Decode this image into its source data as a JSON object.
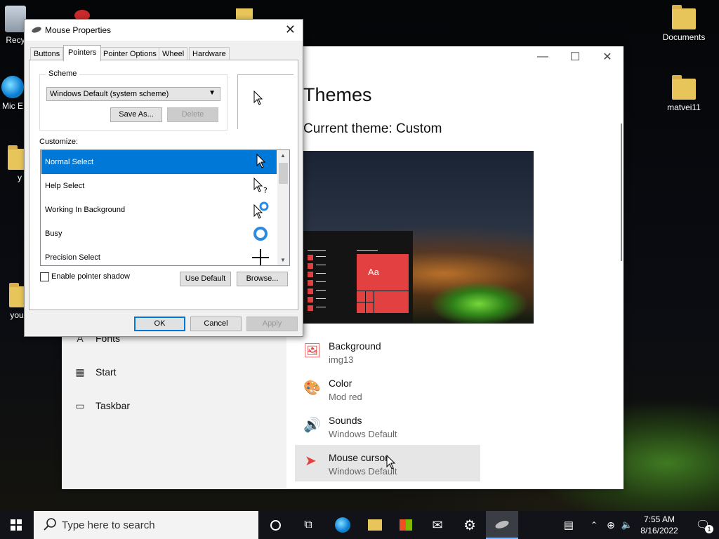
{
  "desktop": {
    "icons": [
      {
        "label": "Recy"
      },
      {
        "label": "Mic E"
      },
      {
        "label": "y"
      },
      {
        "label": "you w"
      },
      {
        "label": "Documents"
      },
      {
        "label": "matvei11"
      }
    ]
  },
  "settings": {
    "title": "Themes",
    "current_theme": "Current theme: Custom",
    "preview_tile_text": "Aa",
    "nav": [
      {
        "label": "Fonts",
        "icon": "fonts-icon"
      },
      {
        "label": "Start",
        "icon": "start-icon"
      },
      {
        "label": "Taskbar",
        "icon": "taskbar-icon"
      }
    ],
    "items": [
      {
        "title": "Background",
        "value": "img13",
        "icon": "picture-icon"
      },
      {
        "title": "Color",
        "value": "Mod red",
        "icon": "palette-icon"
      },
      {
        "title": "Sounds",
        "value": "Windows Default",
        "icon": "speaker-icon"
      },
      {
        "title": "Mouse cursor",
        "value": "Windows Default",
        "icon": "cursor-icon"
      }
    ],
    "accent": "#e34141"
  },
  "dialog": {
    "title": "Mouse Properties",
    "tabs": [
      "Buttons",
      "Pointers",
      "Pointer Options",
      "Wheel",
      "Hardware"
    ],
    "active_tab": "Pointers",
    "scheme_label": "Scheme",
    "scheme_value": "Windows Default (system scheme)",
    "save_as": "Save As...",
    "delete": "Delete",
    "customize_label": "Customize:",
    "pointers": [
      {
        "label": "Normal Select",
        "icon": "arrow-cursor-icon"
      },
      {
        "label": "Help Select",
        "icon": "help-cursor-icon"
      },
      {
        "label": "Working In Background",
        "icon": "working-cursor-icon"
      },
      {
        "label": "Busy",
        "icon": "busy-cursor-icon"
      },
      {
        "label": "Precision Select",
        "icon": "crosshair-cursor-icon"
      }
    ],
    "selected_pointer": "Normal Select",
    "shadow_label": "Enable pointer shadow",
    "use_default": "Use Default",
    "browse": "Browse...",
    "ok": "OK",
    "cancel": "Cancel",
    "apply": "Apply"
  },
  "taskbar": {
    "search_placeholder": "Type here to search",
    "time": "7:55 AM",
    "date": "8/16/2022",
    "notification_count": "1"
  }
}
